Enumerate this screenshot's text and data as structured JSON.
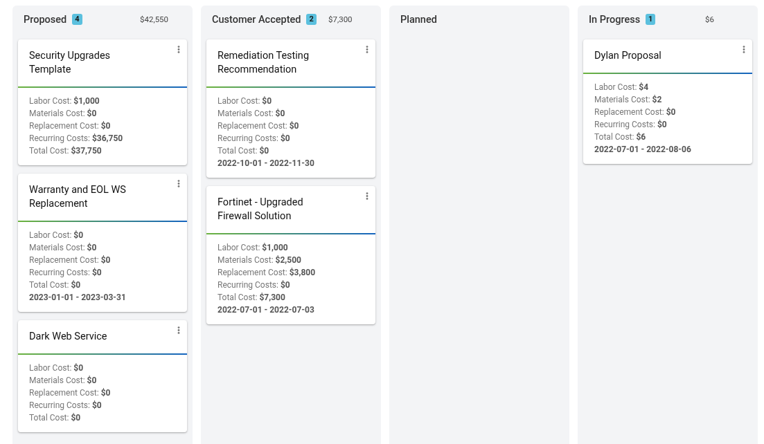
{
  "columns": [
    {
      "title": "Proposed",
      "count": "4",
      "total": "$42,550",
      "cards": [
        {
          "title": "Security Upgrades Template",
          "costs": [
            "Labor Cost: **$1,000**",
            "Materials Cost: **$0**",
            "Replacement Cost: **$0**",
            "Recurring Costs: **$36,750**",
            "Total Cost: **$37,750**"
          ]
        },
        {
          "title": "Warranty and EOL WS Replacement",
          "costs": [
            "Labor Cost: **$0**",
            "Materials Cost: **$0**",
            "Replacement Cost: **$0**",
            "Recurring Costs: **$0**",
            "Total Cost: **$0**"
          ],
          "dates": "2023-01-01 - 2023-03-31"
        },
        {
          "title": "Dark Web Service",
          "costs": [
            "Labor Cost: **$0**",
            "Materials Cost: **$0**",
            "Replacement Cost: **$0**",
            "Recurring Costs: **$0**",
            "Total Cost: **$0**"
          ]
        }
      ]
    },
    {
      "title": "Customer Accepted",
      "count": "2",
      "total": "$7,300",
      "cards": [
        {
          "title": "Remediation Testing Recommendation",
          "costs": [
            "Labor Cost: **$0**",
            "Materials Cost: **$0**",
            "Replacement Cost: **$0**",
            "Recurring Costs: **$0**",
            "Total Cost: **$0**"
          ],
          "dates": "2022-10-01 - 2022-11-30"
        },
        {
          "title": "Fortinet - Upgraded Firewall Solution",
          "costs": [
            "Labor Cost: **$1,000**",
            "Materials Cost: **$2,500**",
            "Replacement Cost: **$3,800**",
            "Recurring Costs: **$0**",
            "Total Cost: **$7,300**"
          ],
          "dates": "2022-07-01 - 2022-07-03"
        }
      ]
    },
    {
      "title": "Planned"
    },
    {
      "title": "In Progress",
      "count": "1",
      "total": "$6",
      "cards": [
        {
          "title": "Dylan Proposal",
          "costs": [
            "Labor Cost: **$4**",
            "Materials Cost: **$2**",
            "Replacement Cost: **$0**",
            "Recurring Costs: **$0**",
            "Total Cost: **$6**"
          ],
          "dates": "2022-07-01 - 2022-08-06"
        }
      ]
    }
  ]
}
